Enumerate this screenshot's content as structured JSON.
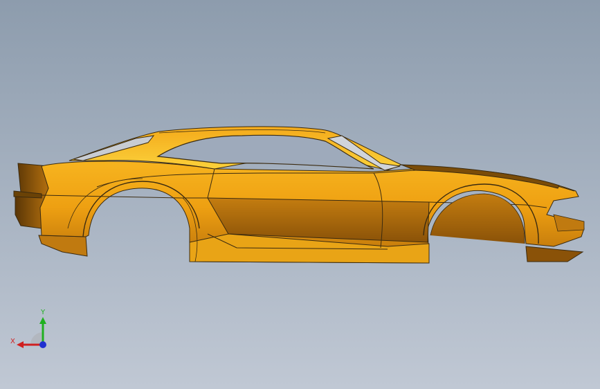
{
  "viewport": {
    "background_top": "#8d9cad",
    "background_bottom": "#c0c8d4"
  },
  "model": {
    "icon": "car-body-shell",
    "body_color": "#e8980a",
    "edge_color": "#3a2a10"
  },
  "triad": {
    "x_label": "X",
    "y_label": "Y",
    "x_color": "#d02020",
    "y_color": "#20b020",
    "z_color": "#2030d0"
  }
}
